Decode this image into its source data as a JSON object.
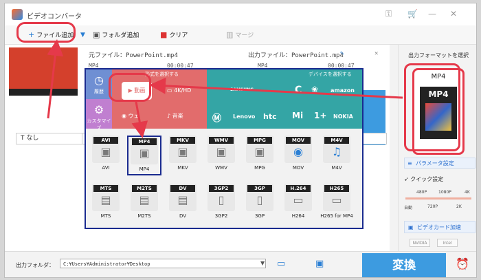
{
  "window": {
    "title": "ビデオコンバータ"
  },
  "toolbar": {
    "add_file": "ファイル追加",
    "add_folder": "フォルダ追加",
    "clear": "クリア",
    "merge": "マージ"
  },
  "file": {
    "source_label": "元ファイル：PowerPoint.mp4",
    "output_label": "出力ファイル：PowerPoint.mp4",
    "src_format": "MP4",
    "src_duration": "00:00:47",
    "out_format": "MP4",
    "out_duration": "00:00:47",
    "subtitle": "なし"
  },
  "popup": {
    "format_header": "形式を選択する",
    "device_header": "デバイスを選択する",
    "nav": [
      {
        "label": "履歴",
        "icon": "clock-icon"
      },
      {
        "label": "カスタマイズ",
        "icon": "gear-icon"
      }
    ],
    "categories": [
      "動画",
      "4K/HD",
      "ウェ",
      "音楽"
    ],
    "devices": [
      "Apple",
      "SAMSUNG",
      "C",
      "Huawei",
      "amazon",
      "Motorola",
      "Lenovo",
      "htc",
      "Mi",
      "OnePlus",
      "NOKIA"
    ],
    "formats_row1": [
      {
        "tag": "AVI",
        "label": "AVI"
      },
      {
        "tag": "MP4",
        "label": "MP4"
      },
      {
        "tag": "MKV",
        "label": "MKV"
      },
      {
        "tag": "WMV",
        "label": "WMV"
      },
      {
        "tag": "MPG",
        "label": "MPG"
      },
      {
        "tag": "MOV",
        "label": "MOV"
      },
      {
        "tag": "M4V",
        "label": "M4V"
      }
    ],
    "formats_row2": [
      {
        "tag": "MTS",
        "label": "MTS"
      },
      {
        "tag": "M2TS",
        "label": "M2TS"
      },
      {
        "tag": "DV",
        "label": "DV"
      },
      {
        "tag": "3GP2",
        "label": "3GP2"
      },
      {
        "tag": "3GP",
        "label": "3GP"
      },
      {
        "tag": "H.264",
        "label": "H264"
      },
      {
        "tag": "H265",
        "label": "H265 for MP4"
      }
    ]
  },
  "right": {
    "header": "出力フォーマットを選択",
    "format": "MP4",
    "format_icon_text": "MP4",
    "param_button": "パラメータ設定",
    "quick_label": "クイック設定",
    "slider_top": [
      "480P",
      "1080P",
      "4K"
    ],
    "slider_bottom": [
      "自動",
      "720P",
      "2K"
    ],
    "gpu": "ビデオカード加速",
    "vendors": [
      "NVIDIA",
      "Intel"
    ]
  },
  "bottom": {
    "output_label": "出力フォルダ：",
    "path": "C:¥Users¥Administrator¥Desktop",
    "convert": "変換"
  },
  "colors": {
    "accent": "#3d9be0",
    "annotation": "#e5394a",
    "popup_border": "#1a2b8f"
  }
}
